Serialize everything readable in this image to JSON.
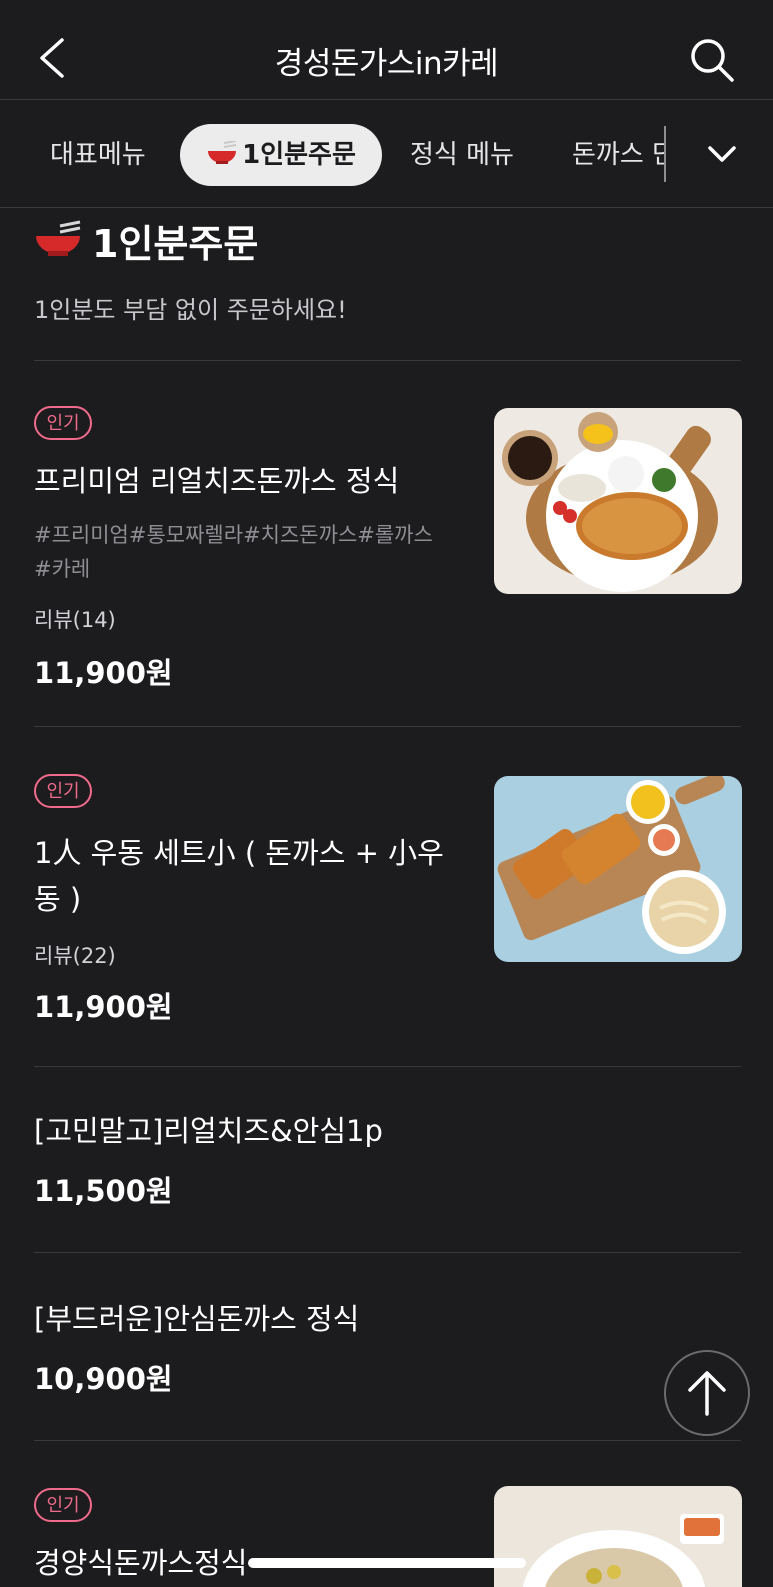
{
  "header": {
    "title": "경성돈가스in카레",
    "back_icon": "chevron-left-icon",
    "search_icon": "search-icon"
  },
  "tabs": [
    {
      "label": "대표메뉴"
    },
    {
      "label": "1인분주문",
      "selected": true
    },
    {
      "label": "정식 메뉴"
    },
    {
      "label": "돈까스 단"
    }
  ],
  "section": {
    "title": "1인분주문",
    "subtitle": "1인분도 부담 없이 주문하세요!"
  },
  "items": [
    {
      "badge": "인기",
      "name": "프리미엄 리얼치즈돈까스 정식",
      "tags_line1": "#프리미엄#통모짜렐라#치즈돈까스#롤까스",
      "tags_line2": "#카레",
      "review": "리뷰(14)",
      "price": "11,900원"
    },
    {
      "badge": "인기",
      "name_line1": "1人 우동 세트小 ( 돈까스 + 小우",
      "name_line2": "동 )",
      "review": "리뷰(22)",
      "price": "11,900원"
    },
    {
      "name": "[고민말고]리얼치즈&안심1p",
      "price": "11,500원"
    },
    {
      "name": "[부드러운]안심돈까스 정식",
      "price": "10,900원"
    },
    {
      "badge": "인기",
      "name": "경양식돈까스정식"
    }
  ],
  "colors": {
    "background": "#1c1c1e",
    "badge": "#f06b8b",
    "selected_tab": "#ececec"
  }
}
